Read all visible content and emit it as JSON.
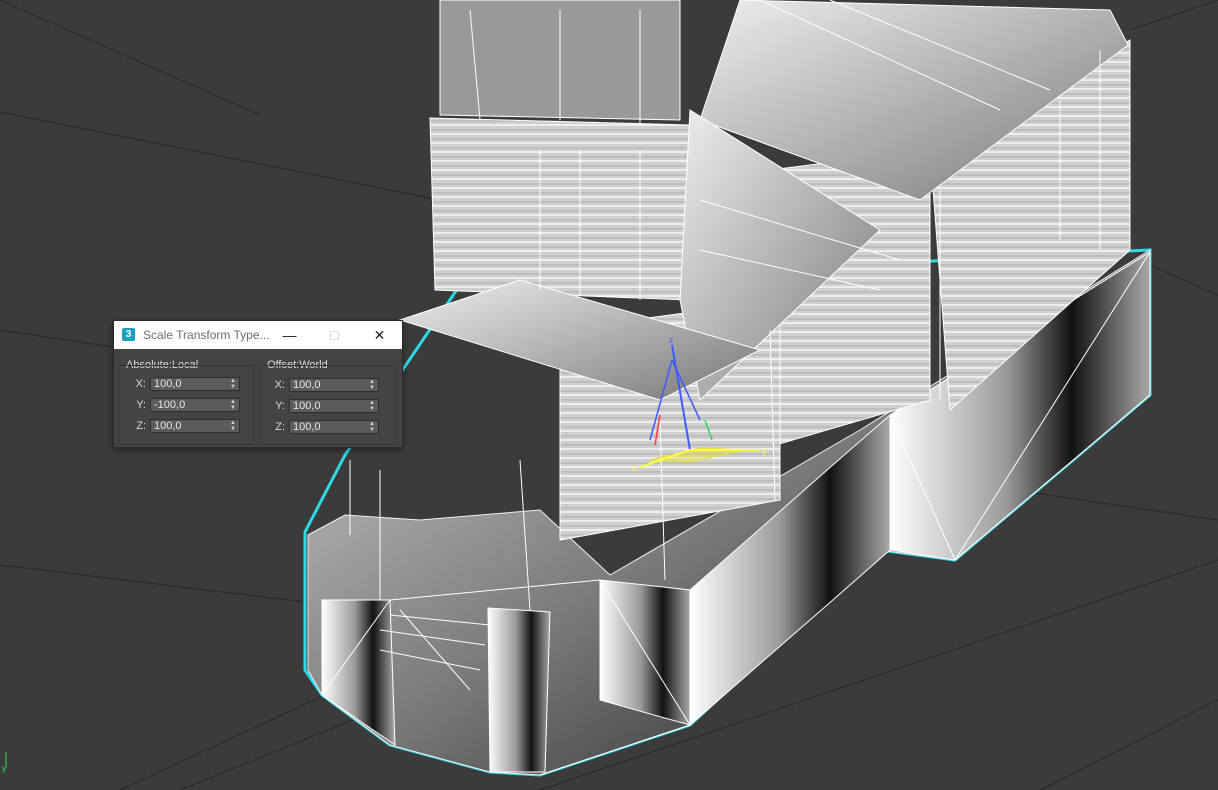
{
  "viewport": {
    "background": "#3a3a3a",
    "selection_color": "#2fd8e6",
    "gizmo_labels": {
      "x": "x",
      "y": "y",
      "z": "z"
    },
    "gizmo_colors": {
      "x": "#ff3b3b",
      "y": "#ffff40",
      "z": "#3d5bff",
      "plane": "#e8e030"
    }
  },
  "dialog": {
    "app_icon": "3",
    "title": "Scale Transform Type...",
    "minimize_icon": "minimize-icon",
    "maximize_icon": "maximize-icon",
    "close_icon": "close-icon",
    "absolute_group": {
      "label": "Absolute:Local",
      "fields": [
        {
          "axis": "X:",
          "value": "100,0"
        },
        {
          "axis": "Y:",
          "value": "-100,0"
        },
        {
          "axis": "Z:",
          "value": "100,0"
        }
      ]
    },
    "offset_group": {
      "label": "Offset:World",
      "fields": [
        {
          "axis": "X:",
          "value": "100,0"
        },
        {
          "axis": "Y:",
          "value": "100,0"
        },
        {
          "axis": "Z:",
          "value": "100,0"
        }
      ]
    }
  }
}
